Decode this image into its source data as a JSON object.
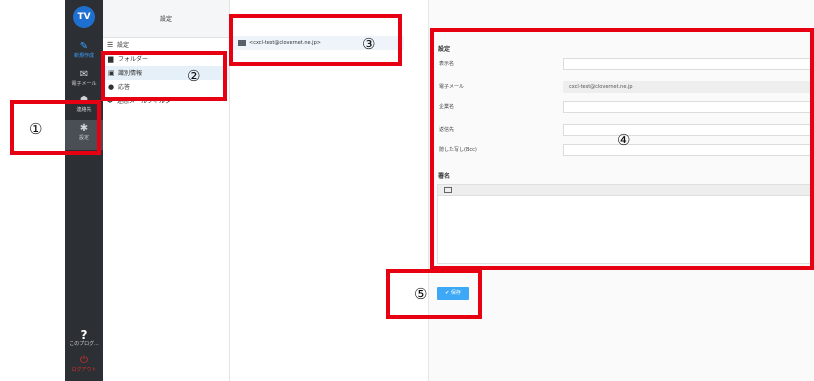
{
  "sidebar": {
    "logo_text": "TV",
    "logo_subtext": "",
    "items": [
      {
        "name": "compose",
        "icon": "pencil-icon",
        "glyph": "✎",
        "label": "新規作成"
      },
      {
        "name": "mail",
        "icon": "mail-icon",
        "glyph": "✉",
        "label": "電子メール"
      },
      {
        "name": "contacts",
        "icon": "contacts-icon",
        "glyph": "☗",
        "label": "連絡先"
      },
      {
        "name": "settings",
        "icon": "gear-icon",
        "glyph": "✱",
        "label": "設定"
      },
      {
        "name": "help",
        "icon": "question-icon",
        "glyph": "?",
        "label": "このプログ..."
      },
      {
        "name": "logout",
        "icon": "power-icon",
        "glyph": "⏻",
        "label": "ログアウト"
      }
    ]
  },
  "settings_menu": {
    "header": "設定",
    "items": [
      {
        "icon": "list-icon",
        "glyph": "☰",
        "label": "設定"
      },
      {
        "icon": "folder-icon",
        "glyph": "▆",
        "label": "フォルダー"
      },
      {
        "icon": "id-card-icon",
        "glyph": "▣",
        "label": "識別情報"
      },
      {
        "icon": "chat-icon",
        "glyph": "●",
        "label": "応答"
      },
      {
        "icon": "gear-icon",
        "glyph": "✱",
        "label": "迷惑メールフィルター"
      }
    ]
  },
  "identities": {
    "items": [
      "<cxcl-test@clovernet.ne.jp>"
    ]
  },
  "identity_form": {
    "title": "設定",
    "fields": [
      {
        "label": "表示名",
        "value": ""
      },
      {
        "label": "電子メール",
        "value": "cxcl-test@clovernet.ne.jp"
      },
      {
        "label": "企業名",
        "value": ""
      },
      {
        "label": "返信先",
        "value": ""
      },
      {
        "label": "隠した写し(Bcc)",
        "value": ""
      }
    ],
    "signature_title": "署名",
    "signature_toolbar_icon": "image-icon"
  },
  "save_button": {
    "icon": "check-icon",
    "glyph": "✔",
    "label": "保存"
  },
  "annotations": [
    "①",
    "②",
    "③",
    "④",
    "⑤"
  ],
  "colors": {
    "annotation": "#e60012",
    "accent": "#3da8f5",
    "sidebar": "#2c2f33"
  }
}
